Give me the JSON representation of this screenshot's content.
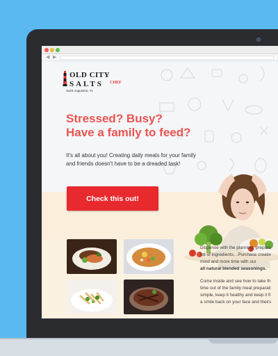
{
  "logo": {
    "line1": "OLD CITY",
    "line2": "SALTS",
    "badge": "CHEF",
    "tagline": "Saint Augustine, FL"
  },
  "hero": {
    "headline_line1": "Stressed?  Busy?",
    "headline_line2": "Have a family to feed?",
    "subtext_line1": "It's all about you!  Creating daily meals for your family",
    "subtext_line2": "and friends doesn't have to be a dreaded task!",
    "cta_label": "Check this out!"
  },
  "side_copy": {
    "p1_line1": "Dispense with the planning, prepara",
    "p1_line2": "list of ingredients…Purchase creativ",
    "p1_line3": "mind and more time with our",
    "p1_bold": "all natural blended seasonings.",
    "p2_line1": "Come inside and see how to take th",
    "p2_line2": "time out of the family meal preparati",
    "p2_line3": "simple, keep it healthy and keep it fl",
    "p2_line4": "a smile back on your face and theirs"
  },
  "colors": {
    "background": "#5ab9f0",
    "accent_red": "#e8292e",
    "headline": "#ea5451",
    "lower_band": "#fbf1e1"
  },
  "icons": {
    "back": "chevron-left-icon",
    "forward": "chevron-right-icon"
  }
}
